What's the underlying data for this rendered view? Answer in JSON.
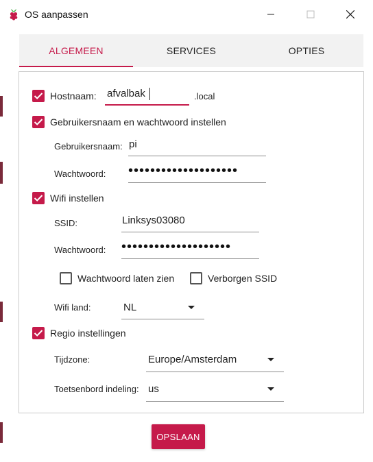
{
  "window": {
    "title": "OS aanpassen"
  },
  "tabs": [
    {
      "label": "ALGEMEEN",
      "active": true
    },
    {
      "label": "SERVICES",
      "active": false
    },
    {
      "label": "OPTIES",
      "active": false
    }
  ],
  "hostname": {
    "checked": true,
    "label": "Hostnaam:",
    "value": "afvalbak",
    "suffix": ".local"
  },
  "user": {
    "checked": true,
    "label": "Gebruikersnaam en wachtwoord instellen",
    "username_label": "Gebruikersnaam:",
    "username_value": "pi",
    "password_label": "Wachtwoord:",
    "password_value": "••••••••••••••••••••"
  },
  "wifi": {
    "checked": true,
    "label": "Wifi instellen",
    "ssid_label": "SSID:",
    "ssid_value": "Linksys03080",
    "password_label": "Wachtwoord:",
    "password_value": "••••••••••••••••••••",
    "show_password": {
      "checked": false,
      "label": "Wachtwoord laten zien"
    },
    "hidden_ssid": {
      "checked": false,
      "label": "Verborgen SSID"
    },
    "country_label": "Wifi land:",
    "country_value": "NL"
  },
  "locale": {
    "checked": true,
    "label": "Regio instellingen",
    "timezone_label": "Tijdzone:",
    "timezone_value": "Europe/Amsterdam",
    "keyboard_label": "Toetsenbord indeling:",
    "keyboard_value": "us"
  },
  "actions": {
    "save_label": "OPSLAAN"
  },
  "colors": {
    "accent": "#c51a4a",
    "tab_bg": "#f2f2f2",
    "border": "#c8c8c8"
  }
}
